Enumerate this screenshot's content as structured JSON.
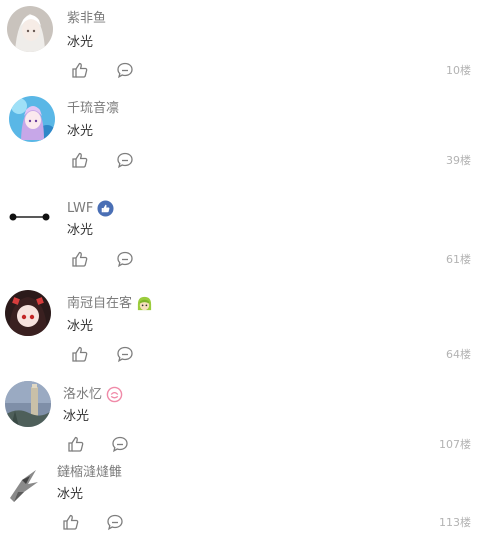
{
  "comments": [
    {
      "username": "紫非鱼",
      "text": "冰光",
      "floor": "10楼",
      "avatar": "white-hair-anime-avatar",
      "badge": null
    },
    {
      "username": "千琉音凛",
      "text": "冰光",
      "floor": "39楼",
      "avatar": "blue-pink-anime-avatar",
      "badge": null
    },
    {
      "username": "LWF",
      "text": "冰光",
      "floor": "61楼",
      "avatar": "line-dots-avatar",
      "badge": "thumb-badge-icon"
    },
    {
      "username": "南冠自在客",
      "text": "冰光",
      "floor": "64楼",
      "avatar": "red-eye-anime-avatar",
      "badge": "green-hair-emoji-icon"
    },
    {
      "username": "洛水忆",
      "text": "冰光",
      "floor": "107楼",
      "avatar": "tower-landscape-avatar",
      "badge": "pink-smile-badge-icon"
    },
    {
      "username": "鐽樎漨熢雔",
      "text": "冰光",
      "floor": "113楼",
      "avatar": "bird-sketch-avatar",
      "badge": null
    }
  ]
}
